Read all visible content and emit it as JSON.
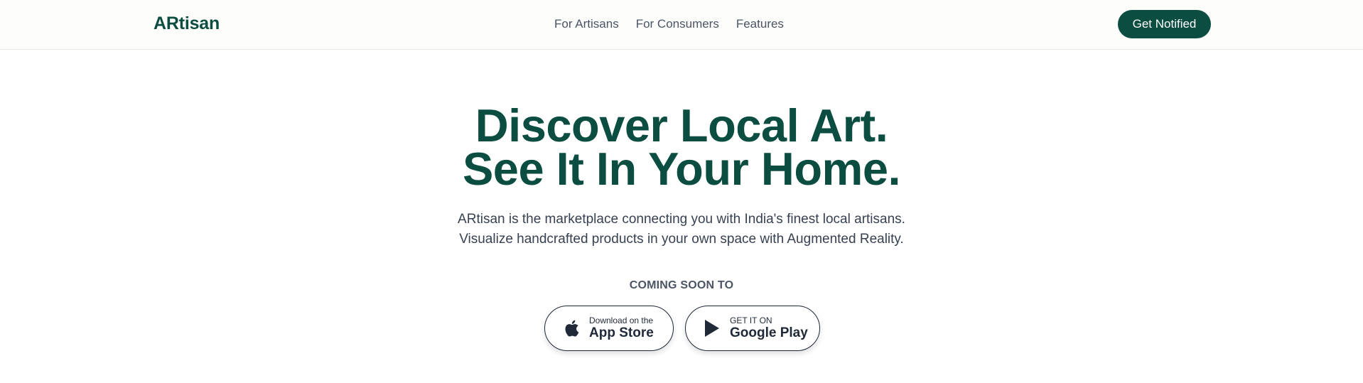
{
  "header": {
    "brand": "ARtisan",
    "nav": [
      {
        "label": "For Artisans"
      },
      {
        "label": "For Consumers"
      },
      {
        "label": "Features"
      }
    ],
    "cta_label": "Get Notified"
  },
  "hero": {
    "title_line1": "Discover Local Art.",
    "title_line2": "See It In Your Home.",
    "subtitle_line1": "ARtisan is the marketplace connecting you with India's finest local artisans.",
    "subtitle_line2": "Visualize handcrafted products in your own space with Augmented Reality.",
    "coming_soon": "COMING SOON TO",
    "stores": [
      {
        "small": "Download on the",
        "big": "App Store",
        "icon": "apple-icon"
      },
      {
        "small": "GET IT ON",
        "big": "Google Play",
        "icon": "play-icon"
      }
    ]
  },
  "colors": {
    "brand": "#0b4d40",
    "text": "#374151",
    "muted": "#4b5563",
    "header_bg": "#fdfdfb"
  }
}
